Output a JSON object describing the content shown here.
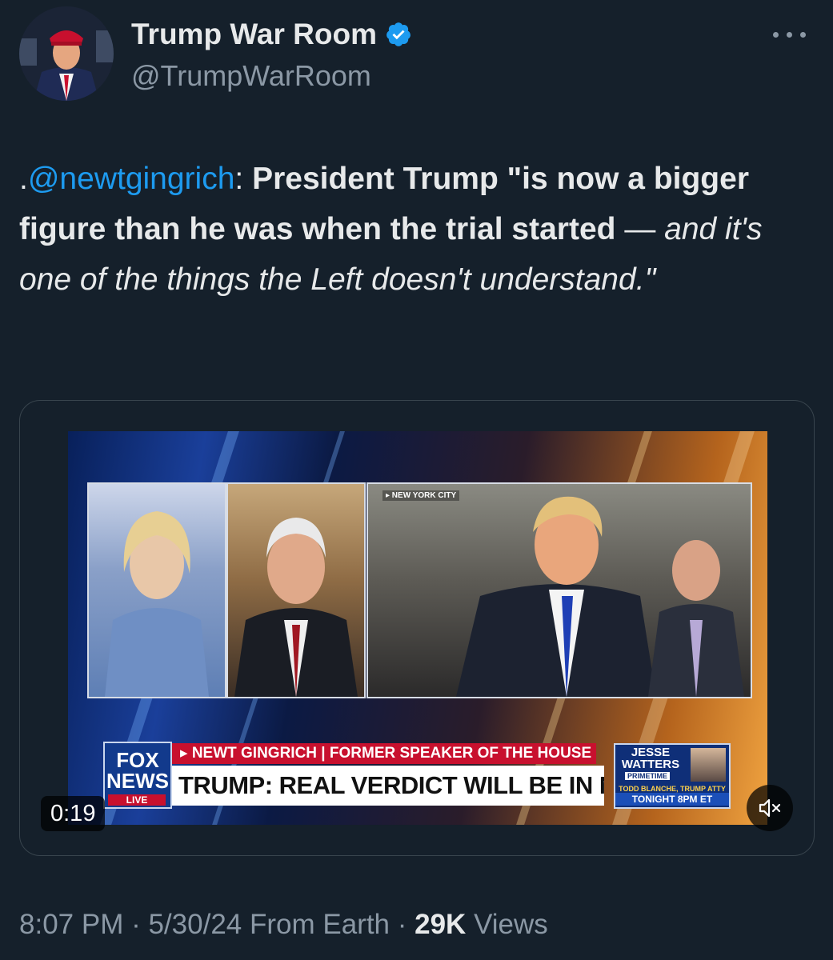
{
  "author": {
    "display_name": "Trump War Room",
    "handle": "@TrumpWarRoom",
    "verified_icon": "verified-badge-icon",
    "verified_color": "#1d9bf0"
  },
  "tweet": {
    "prefix": ".",
    "mention": "@newtgingrich",
    "colon": ": ",
    "bold_text": "President Trump \"is now a bigger figure than he was when the trial started",
    "dash": " — ",
    "italic_text": "and it's one of the things the Left doesn't understand.\""
  },
  "video": {
    "location_tag": "▸ NEW YORK CITY",
    "network_logo_line1": "FOX",
    "network_logo_line2": "NEWS",
    "live_label": "LIVE",
    "banner_top": "▸ NEWT GINGRICH | FORMER SPEAKER OF THE HOUSE",
    "banner_main": "TRUMP: REAL VERDICT WILL BE IN NOVEMBER",
    "promo_show": "JESSE WATTERS",
    "promo_subtitle": "PRIMETIME",
    "promo_guest": "TODD BLANCHE, TRUMP ATTY",
    "promo_time": "TONIGHT 8PM ET",
    "elapsed": "0:19",
    "mute_icon": "speaker-muted-icon"
  },
  "meta": {
    "time": "8:07 PM",
    "sep1": " · ",
    "date": "5/30/24",
    "source": " From Earth",
    "sep2": " · ",
    "views_count": "29K",
    "views_label": " Views"
  },
  "colors": {
    "background": "#15202b",
    "text_primary": "#e7e9ea",
    "text_secondary": "#8b98a5",
    "link": "#1d9bf0",
    "card_border": "#38444d"
  }
}
